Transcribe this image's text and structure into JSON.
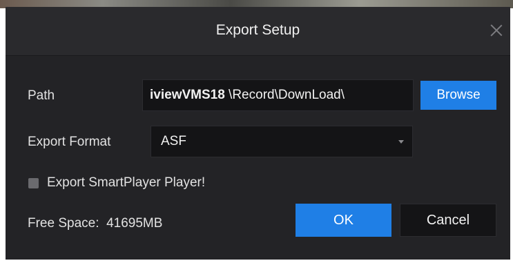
{
  "dialog": {
    "title": "Export Setup",
    "close_icon": "close-icon"
  },
  "path": {
    "label": "Path",
    "value_prefix": "iviewVMS18",
    "value_rest": " \\Record\\DownLoad\\",
    "browse_label": "Browse"
  },
  "format": {
    "label": "Export Format",
    "selected": "ASF"
  },
  "smartplayer": {
    "label": "Export SmartPlayer Player!",
    "checked": false
  },
  "free_space": {
    "label": "Free Space:",
    "value": "41695MB"
  },
  "buttons": {
    "ok_label": "OK",
    "cancel_label": "Cancel"
  },
  "colors": {
    "accent": "#1f7fe6",
    "dialog_bg": "#232326",
    "input_bg": "#141416"
  }
}
